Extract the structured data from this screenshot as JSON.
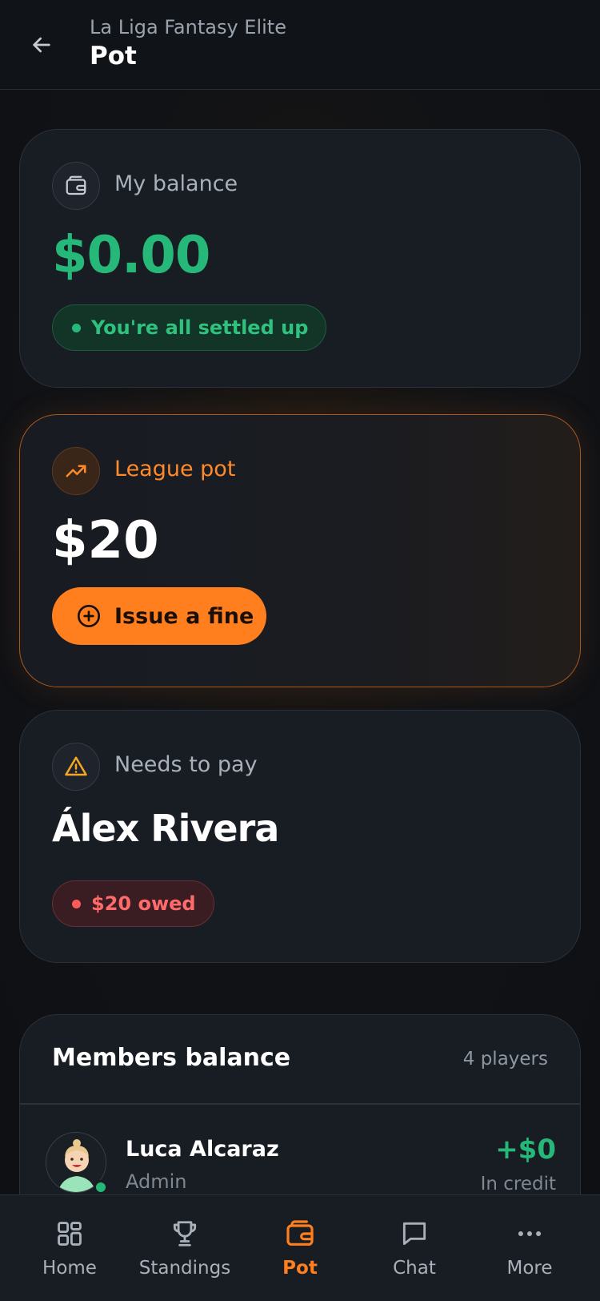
{
  "header": {
    "subtitle": "La Liga Fantasy Elite",
    "title": "Pot"
  },
  "balance_card": {
    "label": "My balance",
    "amount": "$0.00",
    "status": "You're all settled up"
  },
  "pot_card": {
    "label": "League pot",
    "amount": "$20",
    "button_label": "Issue a fine"
  },
  "pay_card": {
    "label": "Needs to pay",
    "name": "Álex Rivera",
    "owed": "$20 owed"
  },
  "members": {
    "title": "Members balance",
    "count": "4 players",
    "rows": [
      {
        "name": "Luca Alcaraz",
        "role": "Admin",
        "amount": "+$0",
        "status": "In credit"
      }
    ]
  },
  "nav": {
    "items": [
      {
        "label": "Home",
        "icon": "grid-icon"
      },
      {
        "label": "Standings",
        "icon": "trophy-icon"
      },
      {
        "label": "Pot",
        "icon": "wallet-icon"
      },
      {
        "label": "Chat",
        "icon": "chat-icon"
      },
      {
        "label": "More",
        "icon": "more-icon"
      }
    ],
    "active": "Pot"
  },
  "colors": {
    "accent": "#ff7f1f",
    "positive": "#25b878",
    "negative": "#ff6b6b",
    "background": "#0f1216",
    "card": "#181c23"
  }
}
